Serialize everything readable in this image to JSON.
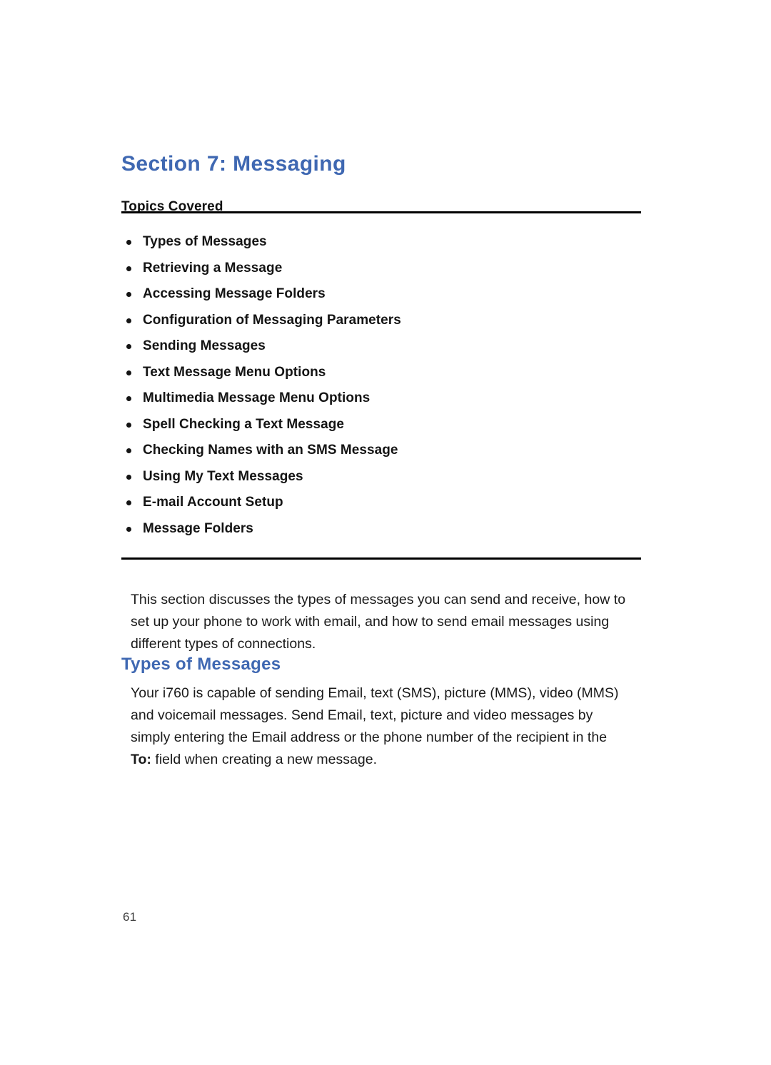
{
  "page": {
    "background_color": "#ffffff",
    "heading_color": "#3f68b2",
    "rule_color": "#000000",
    "page_number": "61"
  },
  "section": {
    "title": "Section 7: Messaging",
    "topics_label": "Topics Covered",
    "topics": [
      "Types of Messages",
      "Retrieving a Message",
      "Accessing Message Folders",
      "Configuration of Messaging Parameters",
      "Sending Messages",
      "Text Message Menu Options",
      "Multimedia Message Menu Options",
      "Spell Checking a Text Message",
      "Checking Names with an SMS Message",
      "Using My Text Messages",
      "E-mail Account Setup",
      "Message Folders"
    ]
  },
  "content": {
    "intro_paragraph": "This section discusses the types of messages you can send and receive, how to set up your phone to work with email, and how to send email messages using different types of connections.",
    "types_heading": "Types of Messages",
    "types_paragraph_part1": "Your i760 is capable of sending Email, text (SMS), picture (MMS), video (MMS) and voicemail messages. Send Email, text, picture and video messages by simply entering the Email address or the phone number of the recipient in the ",
    "types_paragraph_bold": "To:",
    "types_paragraph_part2": " field when creating a new message."
  }
}
